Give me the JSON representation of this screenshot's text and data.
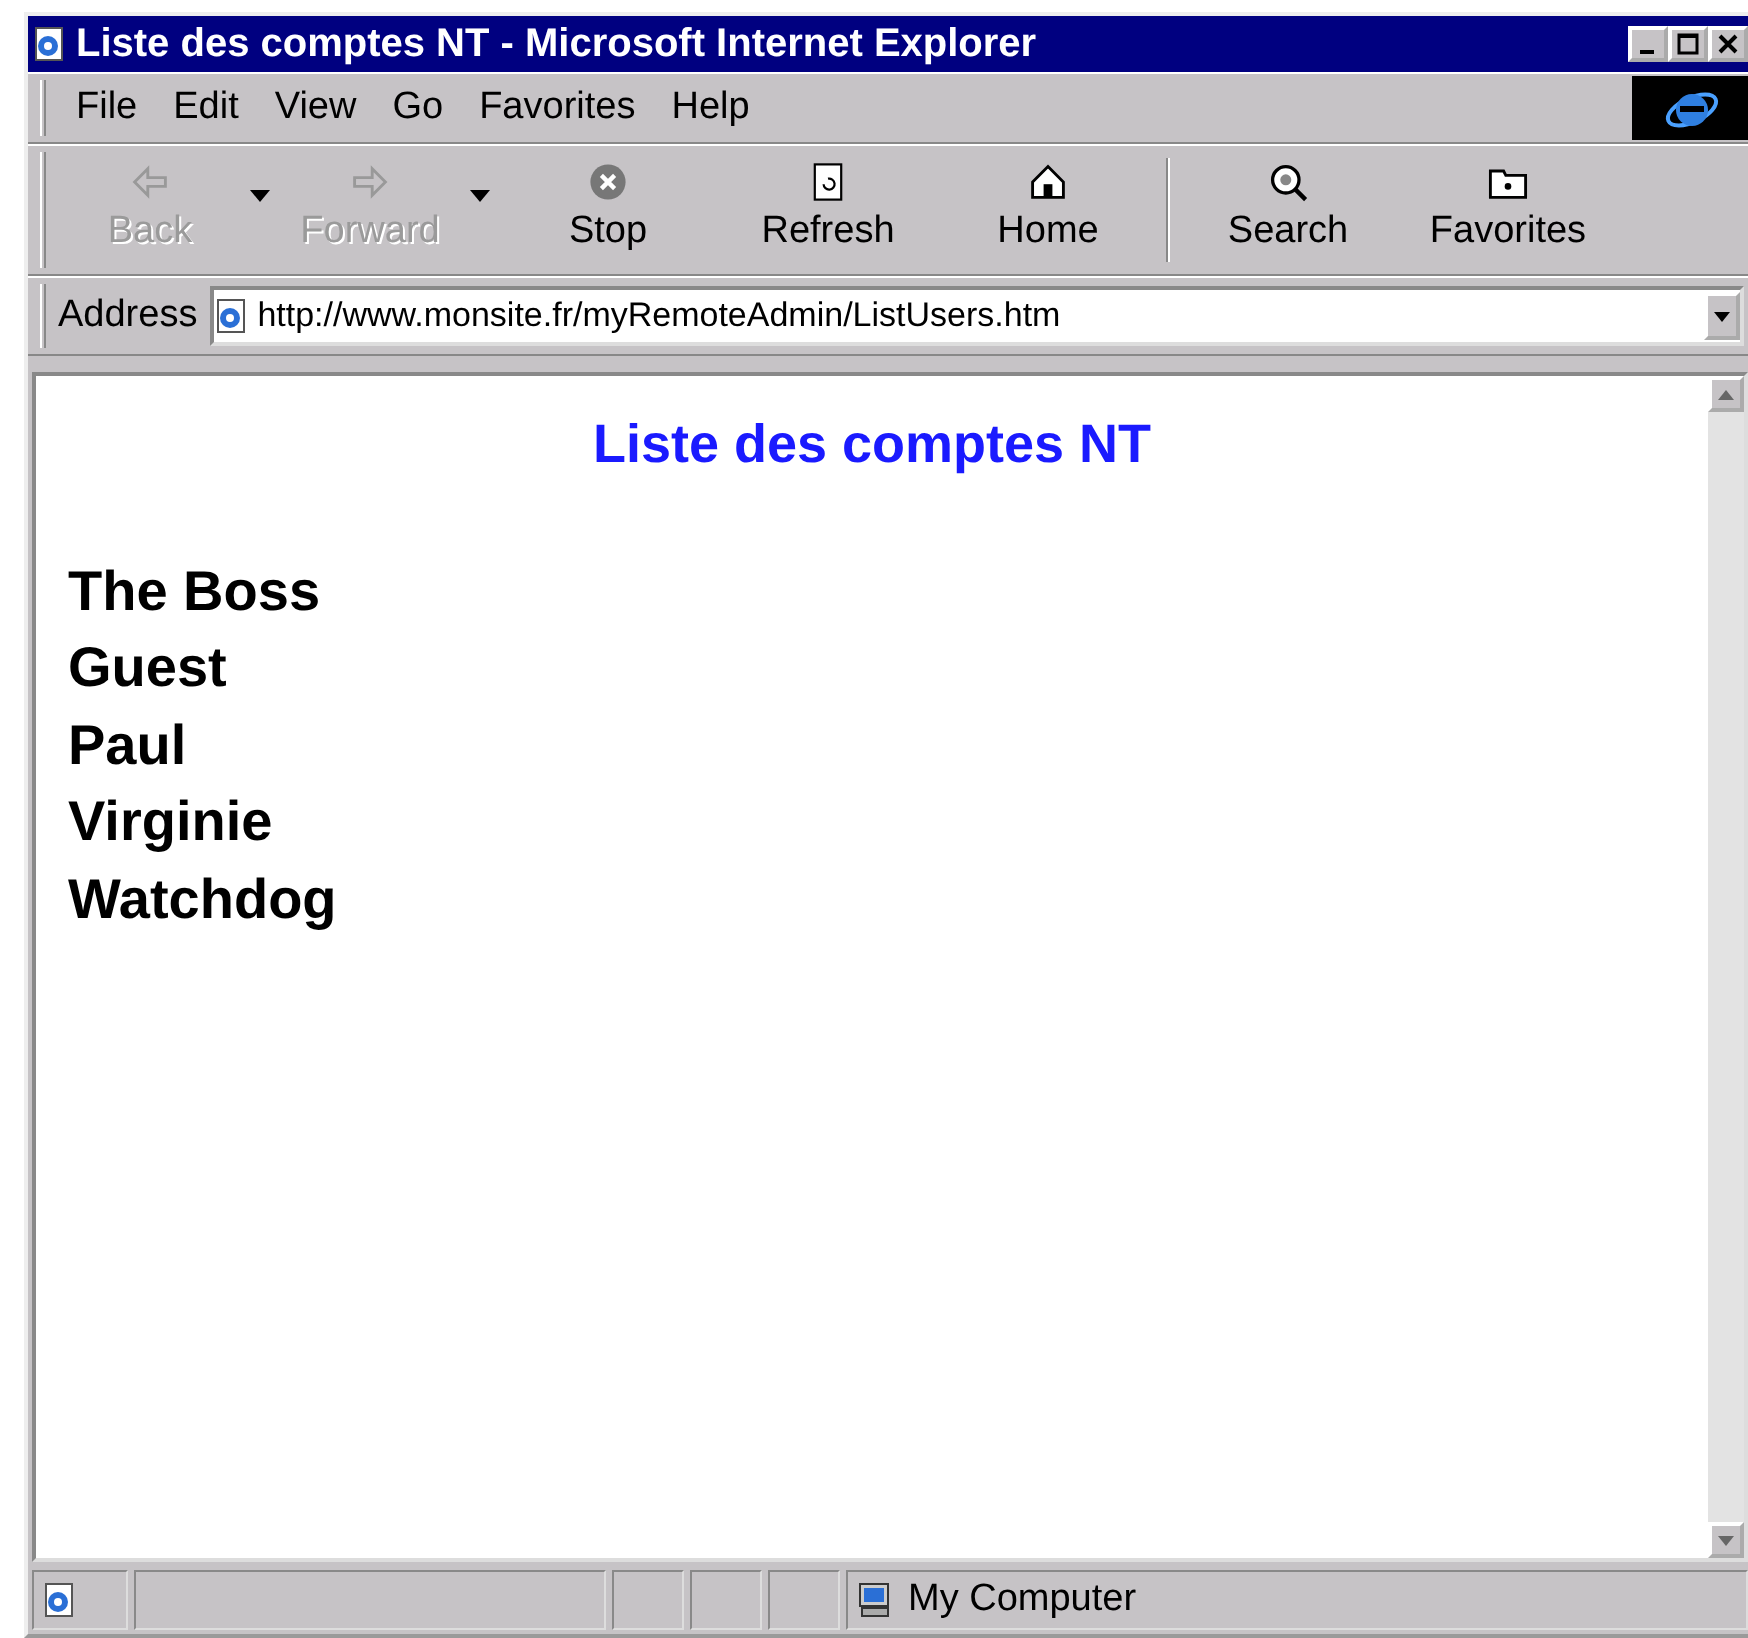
{
  "window": {
    "title": "Liste des comptes NT - Microsoft Internet Explorer"
  },
  "menu": [
    "File",
    "Edit",
    "View",
    "Go",
    "Favorites",
    "Help"
  ],
  "toolbar": [
    {
      "kind": "back",
      "label": "Back",
      "disabled": true,
      "dropdown": true
    },
    {
      "kind": "forward",
      "label": "Forward",
      "disabled": true,
      "dropdown": true
    },
    {
      "kind": "stop",
      "label": "Stop",
      "disabled": false,
      "dropdown": false
    },
    {
      "kind": "refresh",
      "label": "Refresh",
      "disabled": false,
      "dropdown": false
    },
    {
      "kind": "home",
      "label": "Home",
      "disabled": false,
      "dropdown": false
    },
    {
      "kind": "search",
      "label": "Search",
      "disabled": false,
      "dropdown": false
    },
    {
      "kind": "favorites",
      "label": "Favorites",
      "disabled": false,
      "dropdown": false
    }
  ],
  "address": {
    "label": "Address",
    "value": "http://www.monsite.fr/myRemoteAdmin/ListUsers.htm"
  },
  "page": {
    "heading": "Liste des comptes NT",
    "users": [
      "The Boss",
      "Guest",
      "Paul",
      "Virginie",
      "Watchdog"
    ]
  },
  "status_bar": {
    "zone": "My Computer"
  }
}
